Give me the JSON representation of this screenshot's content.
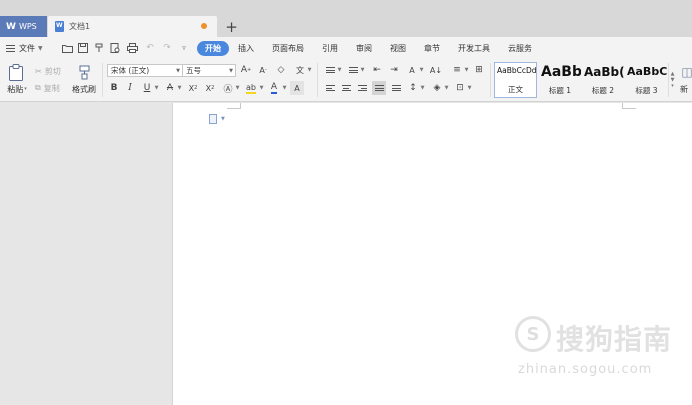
{
  "tabs": {
    "app_label": "WPS",
    "document_label": "文档1",
    "add_symbol": "+"
  },
  "menu": {
    "file_label": "文件",
    "items": [
      "开始",
      "插入",
      "页面布局",
      "引用",
      "审阅",
      "视图",
      "章节",
      "开发工具",
      "云服务"
    ],
    "active_index": 0
  },
  "ribbon": {
    "paste_label": "粘贴",
    "cut_label": "剪切",
    "copy_label": "复制",
    "format_painter_label": "格式刷",
    "font_name": "宋体 (正文)",
    "font_size": "五号",
    "styles": [
      {
        "preview": "AaBbCcDd",
        "name": "正文"
      },
      {
        "preview": "AaBb",
        "name": "标题 1"
      },
      {
        "preview": "AaBb(",
        "name": "标题 2"
      },
      {
        "preview": "AaBbC(",
        "name": "标题 3"
      }
    ],
    "new_style_label": "新"
  },
  "watermark": {
    "logo_char": "S",
    "title": "搜狗指南",
    "url": "zhinan.sogou.com"
  },
  "colors": {
    "accent": "#4a88e0",
    "wps_tab": "#5a7ab8",
    "modified_dot": "#f0902a",
    "font_color_bar": "#2a5bd7",
    "highlight_bar": "#f5d51f"
  }
}
